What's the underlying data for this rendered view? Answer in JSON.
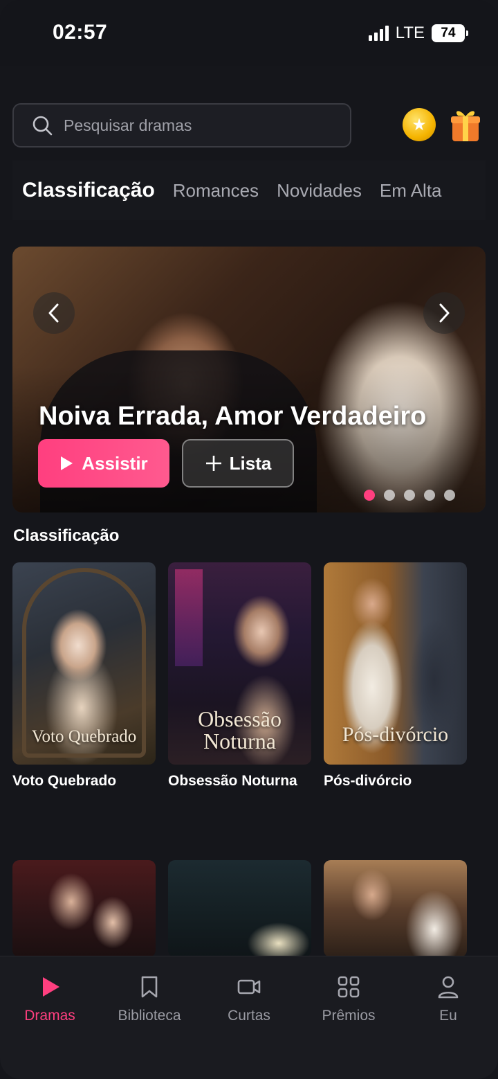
{
  "status_bar": {
    "time": "02:57",
    "network": "LTE",
    "battery": "74"
  },
  "search": {
    "placeholder": "Pesquisar dramas"
  },
  "header_icons": [
    "coin-icon",
    "gift-icon"
  ],
  "tabs": [
    {
      "label": "Classificação",
      "active": true
    },
    {
      "label": "Romances"
    },
    {
      "label": "Novidades"
    },
    {
      "label": "Em Alta"
    }
  ],
  "hero": {
    "title": "Noiva Errada, Amor Verdadeiro",
    "watch_label": "Assistir",
    "list_label": "Lista",
    "slide_count": 5,
    "active_slide": 1
  },
  "section": {
    "title": "Classificação",
    "items": [
      {
        "title": "Voto Quebrado",
        "poster_caption": "Voto Quebrado"
      },
      {
        "title": "Obsessão Noturna",
        "poster_caption": "Obsessão Noturna"
      },
      {
        "title": "Pós-divórcio",
        "poster_caption": "Pós-divórcio"
      }
    ]
  },
  "bottom_nav": [
    {
      "label": "Dramas",
      "icon": "play-icon",
      "active": true
    },
    {
      "label": "Biblioteca",
      "icon": "bookmark-icon"
    },
    {
      "label": "Curtas",
      "icon": "video-camera-icon"
    },
    {
      "label": "Prêmios",
      "icon": "grid-icon"
    },
    {
      "label": "Eu",
      "icon": "user-icon"
    }
  ],
  "colors": {
    "accent": "#ff3f7f",
    "background": "#15161b",
    "inactive_text": "#9a9ba3"
  }
}
